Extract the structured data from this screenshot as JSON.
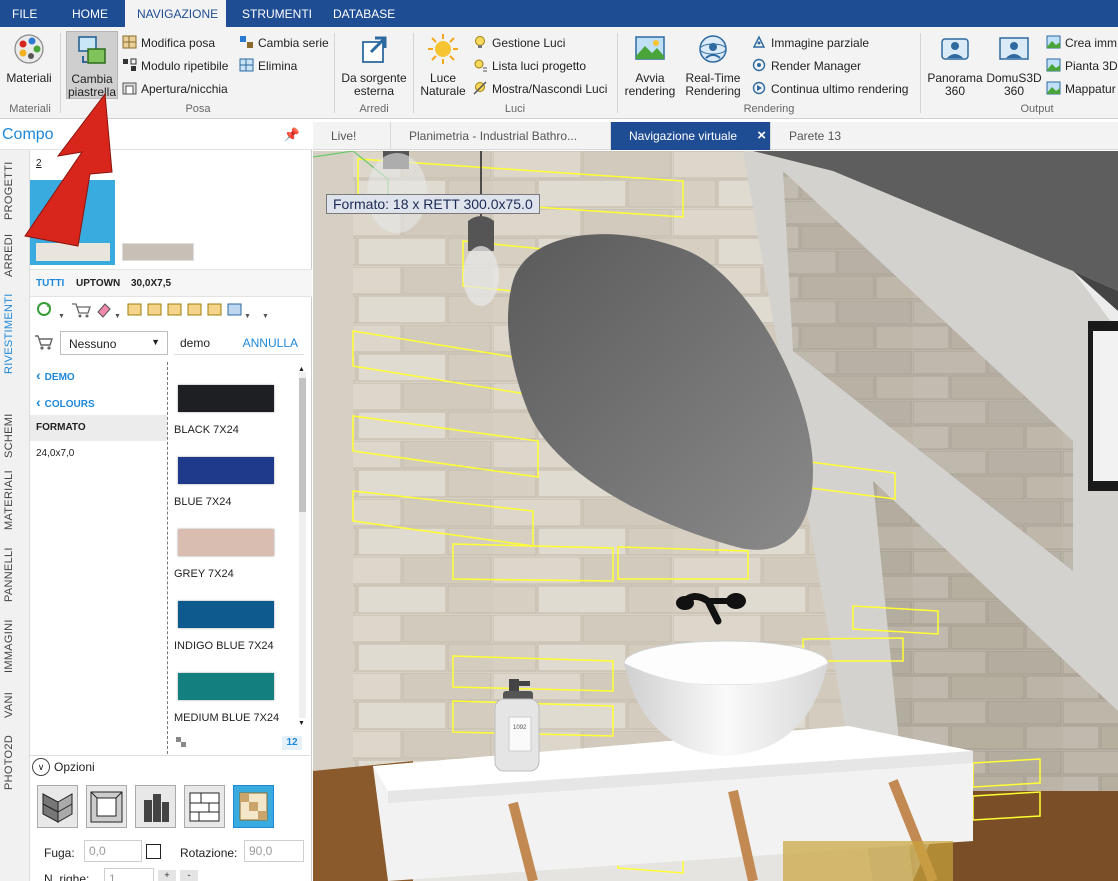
{
  "menubar": {
    "tabs": [
      "FILE",
      "HOME",
      "NAVIGAZIONE",
      "STRUMENTI",
      "DATABASE"
    ],
    "active": "NAVIGAZIONE"
  },
  "ribbon": {
    "materiali": {
      "btn": "Materiali",
      "group": "Materiali"
    },
    "posa": {
      "cambia_piastrella": "Cambia piastrella",
      "modifica_posa": "Modifica posa",
      "modulo_ripetibile": "Modulo ripetibile",
      "apertura_nicchia": "Apertura/nicchia",
      "cambia_serie": "Cambia serie",
      "elimina": "Elimina",
      "group": "Posa"
    },
    "arredi": {
      "sorgente": "Da sorgente esterna",
      "group": "Arredi"
    },
    "luci": {
      "luce_naturale": "Luce Naturale",
      "gestione_luci": "Gestione Luci",
      "lista_luci": "Lista luci progetto",
      "mostra_nascondi": "Mostra/Nascondi Luci",
      "group": "Luci"
    },
    "rendering": {
      "avvia": "Avvia rendering",
      "realtime": "Real-Time Rendering",
      "immagine_parziale": "Immagine parziale",
      "render_manager": "Render Manager",
      "continua": "Continua ultimo rendering",
      "group": "Rendering"
    },
    "output": {
      "panorama": "Panorama 360",
      "domus": "DomuS3D 360",
      "crea": "Crea imm",
      "pianta": "Pianta 3D",
      "mappatura": "Mappatur",
      "group": "Output"
    }
  },
  "doctabs": [
    "Live!",
    "Planimetria - Industrial Bathro...",
    "Navigazione virtuale",
    "Parete 13"
  ],
  "leftpanel": {
    "title": "Compo",
    "vtabs": [
      "PROGETTI",
      "ARREDI",
      "RIVESTIMENTI",
      "SCHEMI",
      "MATERIALI",
      "PANNELLI",
      "IMMAGINI",
      "VANI",
      "PHOTO2D"
    ],
    "active_vtab": "RIVESTIMENTI",
    "thumb_count": "2",
    "filters": [
      "TUTTI",
      "UPTOWN",
      "30,0X7,5"
    ],
    "cart_select": "Nessuno",
    "search_value": "demo",
    "annulla": "ANNULLA",
    "nav": [
      "DEMO",
      "COLOURS"
    ],
    "formato_label": "FORMATO",
    "formato_value": "24,0x7,0",
    "swatches": [
      {
        "label": "BLACK 7X24",
        "color": "#1d1f22"
      },
      {
        "label": "BLUE 7X24",
        "color": "#1f3a8a"
      },
      {
        "label": "GREY 7X24",
        "color": "#d8bdb0"
      },
      {
        "label": "INDIGO BLUE 7X24",
        "color": "#0e5a8e"
      },
      {
        "label": "MEDIUM BLUE 7X24",
        "color": "#13807f"
      }
    ],
    "count": "12",
    "opzioni": "Opzioni",
    "fuga_label": "Fuga:",
    "fuga_value": "0,0",
    "rotazione_label": "Rotazione:",
    "rotazione_value": "90,0",
    "righe_label": "N. righe:",
    "righe_value": "1"
  },
  "viewport": {
    "tooltip": "Formato: 18 x RETT 300.0x75.0",
    "soap_label": "1092"
  },
  "colors": {
    "menubar": "#1e4d94",
    "accent": "#1e88d9",
    "highlight": "#ffff33",
    "arrow": "#d9261c"
  }
}
